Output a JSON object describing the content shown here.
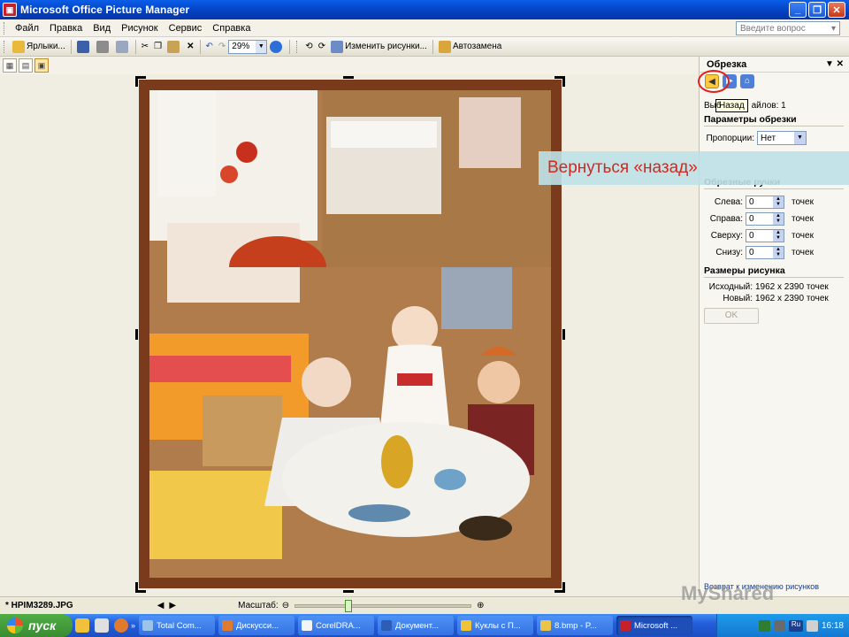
{
  "window": {
    "title": "Microsoft Office Picture Manager"
  },
  "menu": {
    "items": [
      "Файл",
      "Правка",
      "Вид",
      "Рисунок",
      "Сервис",
      "Справка"
    ],
    "ask_placeholder": "Введите вопрос"
  },
  "toolbar": {
    "shortcuts_label": "Ярлыки...",
    "zoom_value": "29%",
    "edit_pictures_label": "Изменить рисунки...",
    "autofix_label": "Автозамена"
  },
  "task_pane": {
    "title": "Обрезка",
    "tooltip": "Назад",
    "selected_files_prefix": "Выб",
    "selected_files_suffix": "айлов: 1",
    "crop_params_title": "Параметры обрезки",
    "proportions_label": "Пропорции:",
    "proportions_value": "Нет",
    "crop_handles_title": "Обрезные ручки",
    "left_label": "Слева:",
    "right_label": "Справа:",
    "top_label": "Сверху:",
    "bottom_label": "Снизу:",
    "left_value": "0",
    "right_value": "0",
    "top_value": "0",
    "bottom_value": "0",
    "unit": "точек",
    "size_title": "Размеры рисунка",
    "original_label": "Исходный:",
    "original_value": "1962 x 2390 точек",
    "new_label": "Новый:",
    "new_value": "1962 x 2390 точек",
    "ok_label": "OK",
    "bottom_link": "Возврат к изменению рисунков"
  },
  "callout": {
    "text": "Вернуться «назад»"
  },
  "status": {
    "file_name": "* HPIM3289.JPG",
    "zoom_label": "Масштаб:",
    "zoom_level": 0.29
  },
  "taskbar": {
    "start_label": "пуск",
    "tasks": [
      "Total Com...",
      "Дискусси...",
      "CorelDRA...",
      "Документ...",
      "Куклы с П...",
      "8.bmp - P...",
      "Microsoft ..."
    ],
    "lang": "Ru",
    "clock": "16:18"
  },
  "watermark": "MyShared"
}
